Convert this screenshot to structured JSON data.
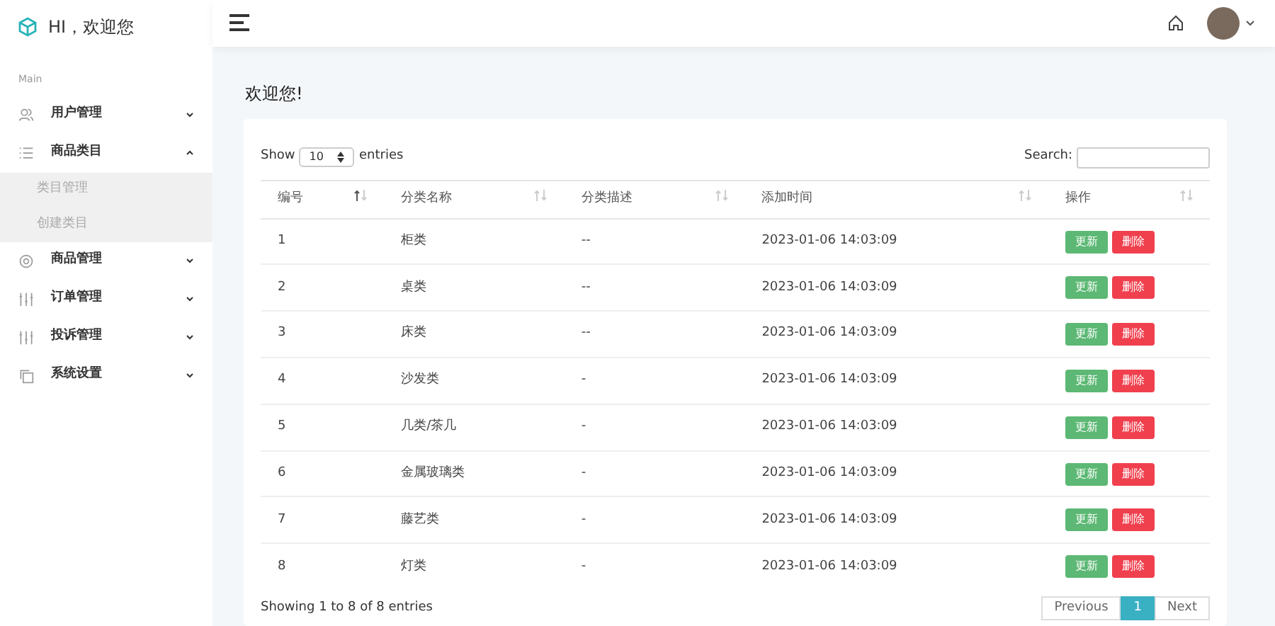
{
  "brand": {
    "title": "HI，欢迎您"
  },
  "sidebar": {
    "section": "Main",
    "items": [
      {
        "label": "用户管理",
        "expanded": false
      },
      {
        "label": "商品类目",
        "expanded": true,
        "children": [
          {
            "label": "类目管理"
          },
          {
            "label": "创建类目"
          }
        ]
      },
      {
        "label": "商品管理",
        "expanded": false
      },
      {
        "label": "订单管理",
        "expanded": false
      },
      {
        "label": "投诉管理",
        "expanded": false
      },
      {
        "label": "系统设置",
        "expanded": false
      }
    ]
  },
  "page": {
    "title": "欢迎您!"
  },
  "table": {
    "length_label_before": "Show",
    "length_value": "10",
    "length_label_after": "entries",
    "search_label": "Search:",
    "columns": [
      {
        "label": "编号",
        "sorted": true
      },
      {
        "label": "分类名称",
        "sorted": false
      },
      {
        "label": "分类描述",
        "sorted": false
      },
      {
        "label": "添加时间",
        "sorted": false
      },
      {
        "label": "操作",
        "sorted": false
      }
    ],
    "rows": [
      {
        "id": "1",
        "name": "柜类",
        "desc": "--",
        "time": "2023-01-06 14:03:09",
        "actions": [
          "更新",
          "删除"
        ]
      },
      {
        "id": "2",
        "name": "桌类",
        "desc": "--",
        "time": "2023-01-06 14:03:09",
        "actions": [
          "更新",
          "删除"
        ]
      },
      {
        "id": "3",
        "name": "床类",
        "desc": "--",
        "time": "2023-01-06 14:03:09",
        "actions": [
          "更新",
          "删除"
        ]
      },
      {
        "id": "4",
        "name": "沙发类",
        "desc": "-",
        "time": "2023-01-06 14:03:09",
        "actions": [
          "更新",
          "删除"
        ]
      },
      {
        "id": "5",
        "name": "几类/茶几",
        "desc": "-",
        "time": "2023-01-06 14:03:09",
        "actions": [
          "更新",
          "删除"
        ]
      },
      {
        "id": "6",
        "name": "金属玻璃类",
        "desc": "-",
        "time": "2023-01-06 14:03:09",
        "actions": [
          "更新",
          "删除"
        ]
      },
      {
        "id": "7",
        "name": "藤艺类",
        "desc": "-",
        "time": "2023-01-06 14:03:09",
        "actions": [
          "更新",
          "删除"
        ]
      },
      {
        "id": "8",
        "name": "灯类",
        "desc": "-",
        "time": "2023-01-06 14:03:09",
        "actions": [
          "更新",
          "删除"
        ]
      }
    ],
    "info": "Showing 1 to 8 of 8 entries",
    "pagination": [
      {
        "label": "Previous",
        "selected": false
      },
      {
        "label": "1",
        "selected": true
      },
      {
        "label": "Next",
        "selected": false
      }
    ]
  }
}
